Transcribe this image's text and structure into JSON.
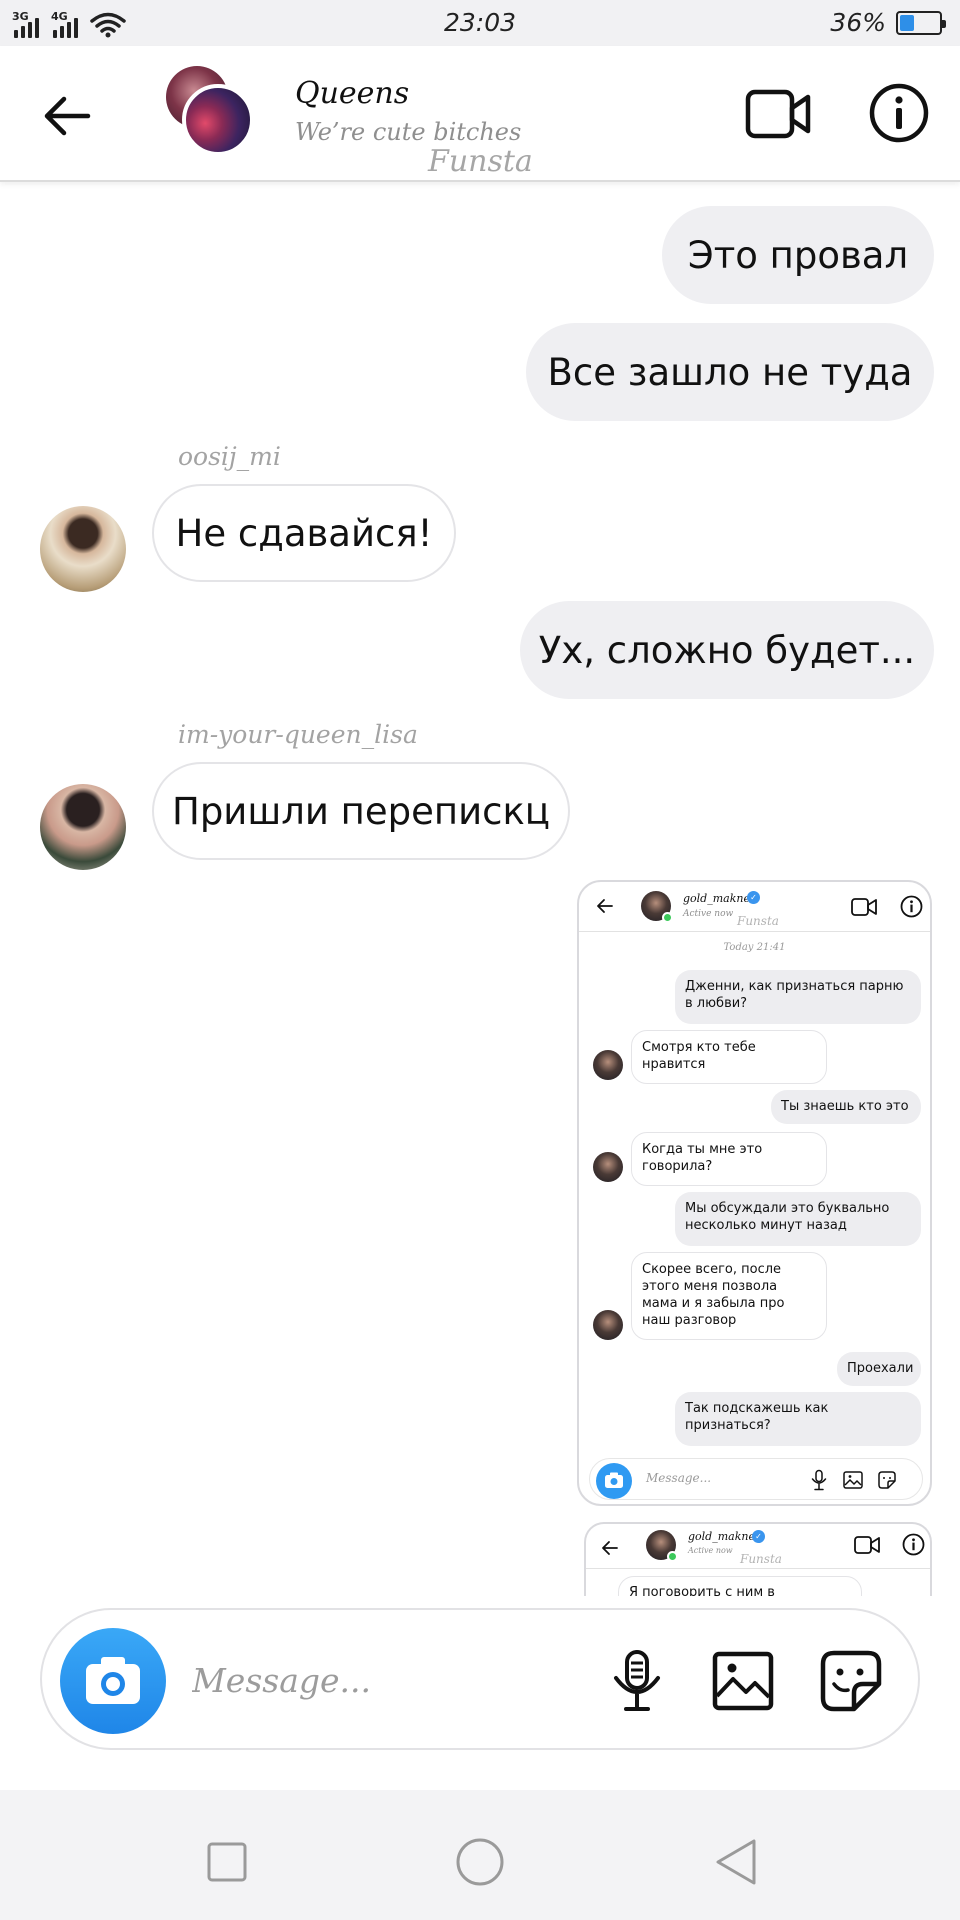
{
  "status_bar": {
    "network_1": "3G",
    "network_2": "4G",
    "time": "23:03",
    "battery_text": "36%",
    "battery_level": 0.36,
    "accent": "#2e8fe8"
  },
  "header": {
    "title": "Queens",
    "subtitle": "We’re cute bitches",
    "watermark": "Funsta",
    "icons": [
      "back-arrow-icon",
      "video-camera-icon",
      "info-icon"
    ]
  },
  "messages": [
    {
      "direction": "out",
      "text": "Это провал"
    },
    {
      "direction": "out",
      "text": "Все зашло не туда"
    },
    {
      "direction": "in",
      "username": "oosij_mi",
      "text": "Не сдавайся!"
    },
    {
      "direction": "out",
      "text": "Ух, сложно будет..."
    },
    {
      "direction": "in",
      "username": "im-your-queen_lisa",
      "text": "Пришли перепискц"
    }
  ],
  "shared_screenshot": {
    "name": "gold_makne",
    "status": "Active now",
    "watermark": "Funsta",
    "date": "Today 21:41",
    "messages": [
      {
        "direction": "out",
        "text": "Дженни, как признаться парню в любви?"
      },
      {
        "direction": "in",
        "text": "Смотря кто тебе нравится"
      },
      {
        "direction": "out",
        "text": "Ты знаешь кто это"
      },
      {
        "direction": "in",
        "text": "Когда ты мне это говорила?"
      },
      {
        "direction": "out",
        "text": "Мы обсуждали это буквально несколько минут назад"
      },
      {
        "direction": "in",
        "text": "Скорее всего, после этого меня позвола мама и я забыла про наш разговор"
      },
      {
        "direction": "out",
        "text": "Проехали"
      },
      {
        "direction": "out",
        "text": "Так подскажешь как признаться?"
      }
    ],
    "input_placeholder": "Message..."
  },
  "shared_screenshot_2": {
    "name": "gold_makne",
    "status": "Active now",
    "watermark": "Funsta",
    "partial_text": "Я поговорить с ним в"
  },
  "composer": {
    "placeholder": "Message...",
    "icons": [
      "camera-icon",
      "microphone-icon",
      "gallery-icon",
      "sticker-icon"
    ],
    "camera_color": "#2196f3"
  },
  "navbar": {
    "icons": [
      "recent-apps-icon",
      "home-icon",
      "back-icon"
    ]
  }
}
